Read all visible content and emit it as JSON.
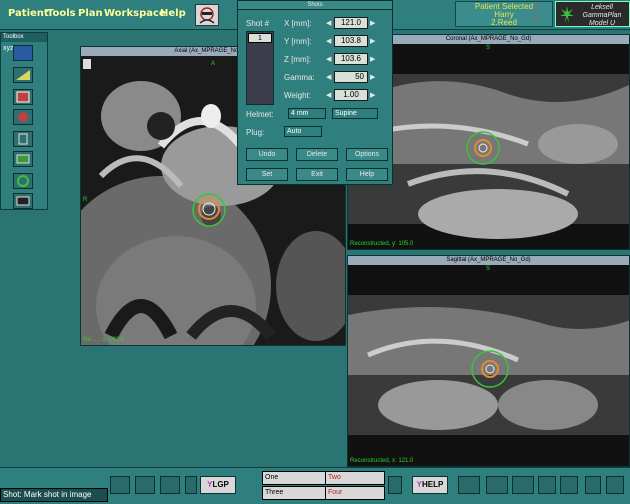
{
  "menubar": {
    "items": [
      "Patient",
      "Tools",
      "Plan",
      "Workspace",
      "Help"
    ],
    "patient_status": "Patient Selected",
    "patient_first": "Harry",
    "patient_last": "2.Reed",
    "logo_lines": [
      "Leksell",
      "GammaPlan",
      "Model U"
    ]
  },
  "toolbox": {
    "title": "Toolbox"
  },
  "axial": {
    "title": "Axial (Ax_MPRAGE_No_Gd)",
    "label_a": "A",
    "label_r": "R",
    "recon": "Re... ...s: 103.8"
  },
  "coronal": {
    "title": "Coronal (Ax_MPRAGE_No_Gd)",
    "label_s": "S",
    "recon": "Reconstructed, y: 105.0"
  },
  "sagittal": {
    "title": "Sagittal (Ax_MPRAGE_No_Gd)",
    "label_s": "S",
    "recon": "Reconstructed, x: 121.0"
  },
  "shots": {
    "title": "Shots",
    "shot_label": "Shot #",
    "shot_selected": "1",
    "x_label": "X [mm]:",
    "x_value": "121.0",
    "y_label": "Y [mm]:",
    "y_value": "103.8",
    "z_label": "Z [mm]:",
    "z_value": "103.6",
    "gamma_label": "Gamma:",
    "gamma_value": "50",
    "weight_label": "Weight:",
    "weight_value": "1.00",
    "helmet_label": "Helmet:",
    "helmet_value": "4 mm",
    "position_value": "Supine",
    "plug_label": "Plug:",
    "plug_value": "Auto",
    "undo": "Undo",
    "delete": "Delete",
    "options": "Options",
    "set": "Set",
    "exit": "Exit",
    "help": "Help"
  },
  "bottombar": {
    "one": "One",
    "two": "Two",
    "three": "Three",
    "four": "Four",
    "lgp": "LGP",
    "help": "HELP"
  },
  "status": "Shot: Mark shot in image"
}
